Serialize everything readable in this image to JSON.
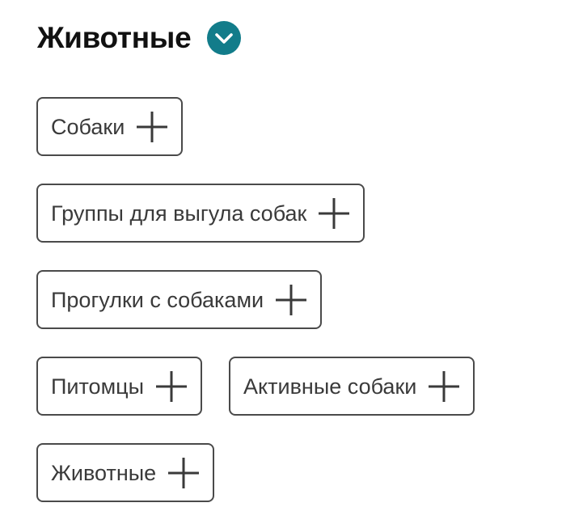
{
  "section": {
    "title": "Животные",
    "toggle_icon": "chevron-down-icon",
    "accent_color": "#127c8a"
  },
  "chips": [
    [
      {
        "label": "Собаки",
        "icon": "plus-icon"
      }
    ],
    [
      {
        "label": "Группы для выгула собак",
        "icon": "plus-icon"
      }
    ],
    [
      {
        "label": "Прогулки с собаками",
        "icon": "plus-icon"
      }
    ],
    [
      {
        "label": "Питомцы",
        "icon": "plus-icon"
      },
      {
        "label": "Активные собаки",
        "icon": "plus-icon"
      }
    ],
    [
      {
        "label": "Животные",
        "icon": "plus-icon"
      }
    ]
  ]
}
